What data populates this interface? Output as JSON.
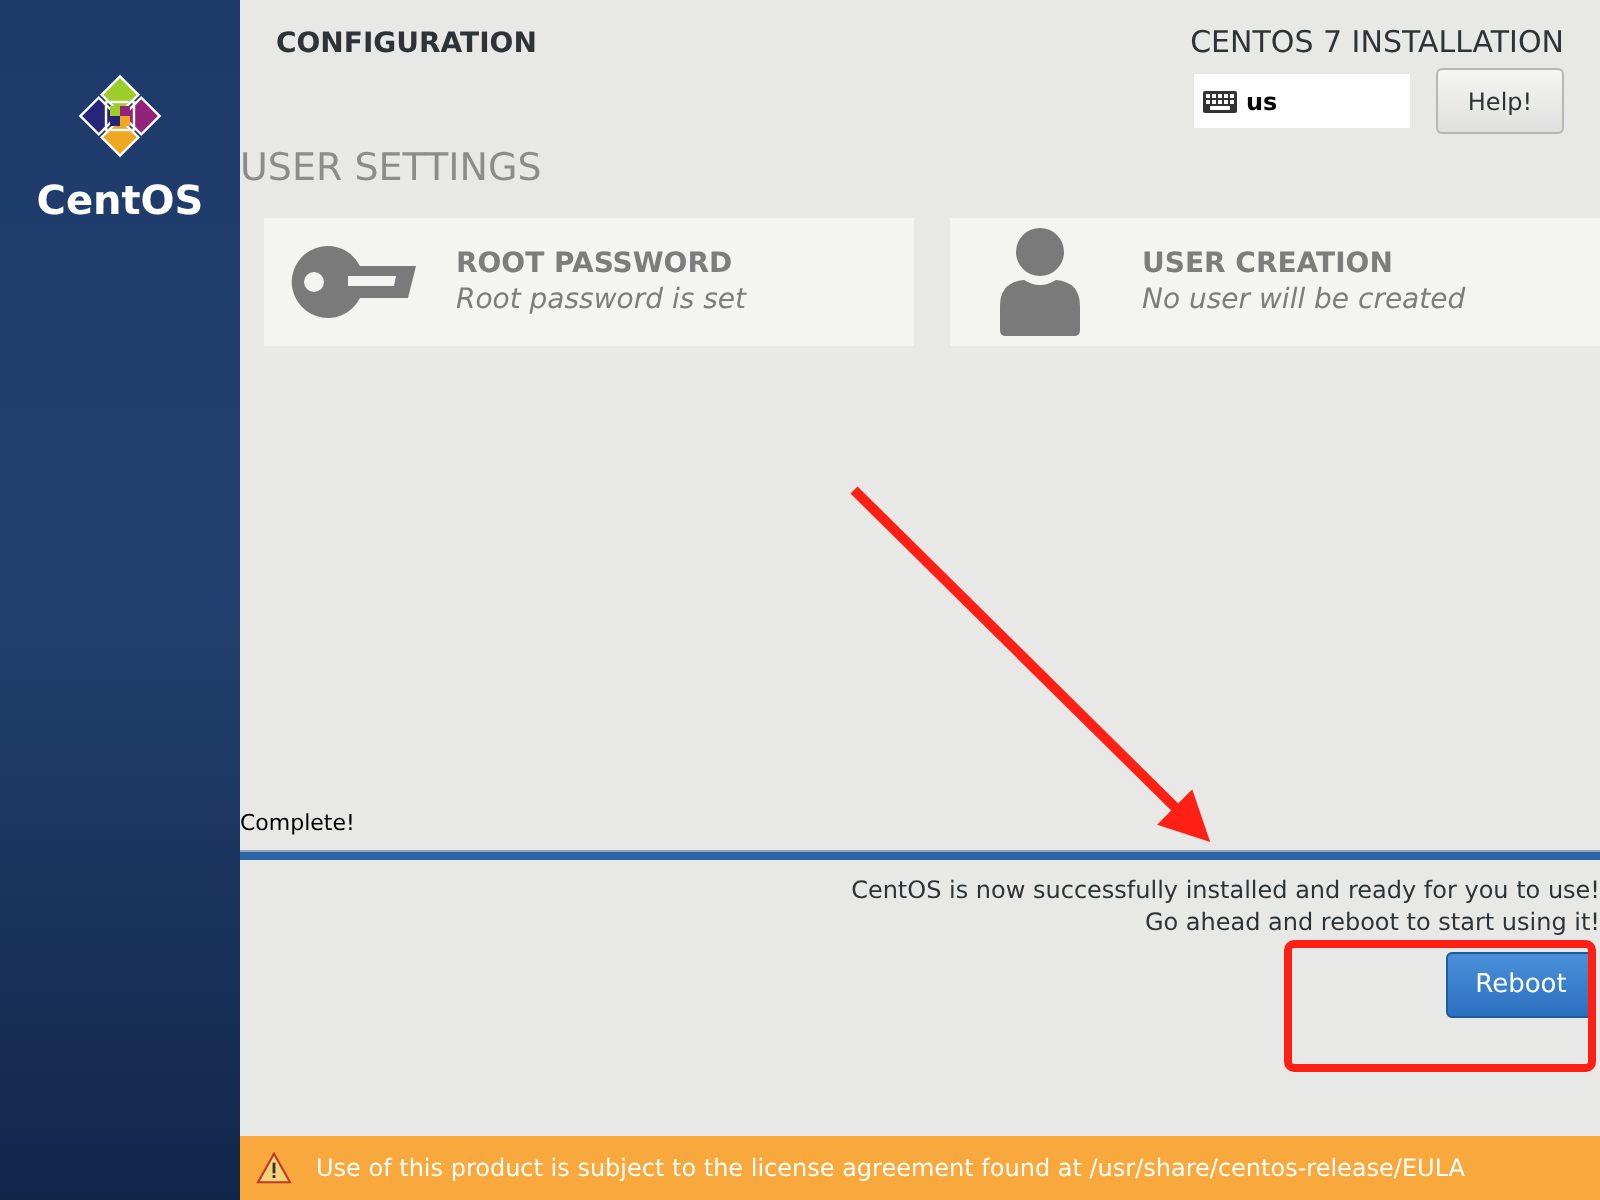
{
  "sidebar": {
    "logo_text": "CentOS"
  },
  "header": {
    "title": "CONFIGURATION",
    "product": "CENTOS 7 INSTALLATION",
    "keyboard_layout": "us",
    "help_button": "Help!"
  },
  "section": {
    "title": "USER SETTINGS",
    "spokes": [
      {
        "kind": "key",
        "title": "ROOT PASSWORD",
        "status": "Root password is set"
      },
      {
        "kind": "user",
        "title": "USER CREATION",
        "status": "No user will be created"
      }
    ]
  },
  "progress": {
    "label": "Complete!",
    "level": 1,
    "messages": [
      "CentOS is now successfully installed and ready for you to use!",
      "Go ahead and reboot to start using it!"
    ]
  },
  "reboot_button": "Reboot",
  "footer": {
    "warning": "Use of this product is subject to the license agreement found at /usr/share/centos-release/EULA"
  }
}
